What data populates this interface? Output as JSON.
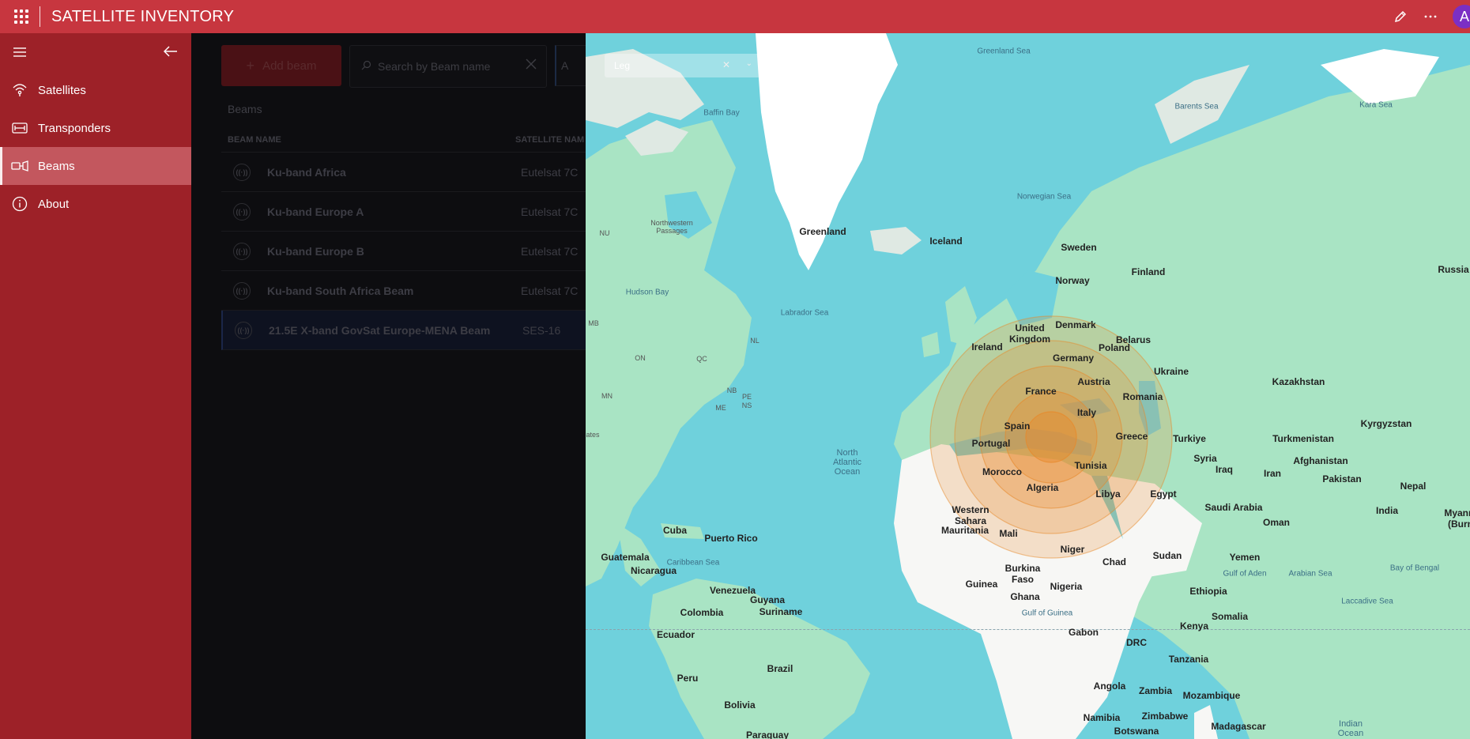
{
  "app": {
    "title": "SATELLITE INVENTORY",
    "avatar_initial": "A"
  },
  "sidebar": {
    "items": [
      {
        "label": "Satellites",
        "icon": "satellite-dish-icon"
      },
      {
        "label": "Transponders",
        "icon": "transponder-icon"
      },
      {
        "label": "Beams",
        "icon": "beam-icon",
        "active": true
      },
      {
        "label": "About",
        "icon": "info-icon"
      }
    ]
  },
  "toolbar": {
    "add_label": "Add beam",
    "search_placeholder": "Search by Beam name",
    "more_label": "A"
  },
  "grid": {
    "title": "Beams",
    "columns": [
      "BEAM NAME",
      "SATELLITE NAM"
    ],
    "rows": [
      {
        "beam": "Ku-band Africa",
        "satellite": "Eutelsat 7C"
      },
      {
        "beam": "Ku-band Europe A",
        "satellite": "Eutelsat 7C"
      },
      {
        "beam": "Ku-band Europe B",
        "satellite": "Eutelsat 7C"
      },
      {
        "beam": "Ku-band South Africa Beam",
        "satellite": "Eutelsat 7C"
      },
      {
        "beam": "21.5E X-band GovSat Europe-MENA Beam",
        "satellite": "SES-16",
        "selected": true
      }
    ]
  },
  "map": {
    "legend_label": "Leg",
    "labels": {
      "greenland_sea": "Greenland Sea",
      "baffin_bay": "Baffin Bay",
      "barents_sea": "Barents Sea",
      "kara_sea": "Kara Sea",
      "norwegian_sea": "Norwegian Sea",
      "greenland": "Greenland",
      "iceland": "Iceland",
      "nw_passages": "Northwestern\nPassages",
      "nu": "NU",
      "hudson_bay": "Hudson Bay",
      "labrador_sea": "Labrador Sea",
      "sweden": "Sweden",
      "finland": "Finland",
      "norway": "Norway",
      "russia": "Russia",
      "united_kingdom": "United\nKingdom",
      "ireland": "Ireland",
      "denmark": "Denmark",
      "belarus": "Belarus",
      "poland": "Poland",
      "germany": "Germany",
      "ukraine": "Ukraine",
      "austria": "Austria",
      "france": "France",
      "romania": "Romania",
      "italy": "Italy",
      "kazakhstan": "Kazakhstan",
      "spain": "Spain",
      "portugal": "Portugal",
      "greece": "Greece",
      "turkiye": "Turkiye",
      "kyrgyzstan": "Kyrgyzstan",
      "turkmenistan": "Turkmenistan",
      "tunisia": "Tunisia",
      "syria": "Syria",
      "afghanistan": "Afghanistan",
      "iraq": "Iraq",
      "iran": "Iran",
      "pakistan": "Pakistan",
      "morocco": "Morocco",
      "algeria": "Algeria",
      "libya": "Libya",
      "egypt": "Egypt",
      "north_atlantic": "North\nAtlantic\nOcean",
      "western_sahara": "Western\nSahara",
      "saudi_arabia": "Saudi Arabia",
      "oman": "Oman",
      "india": "India",
      "nepal": "Nepal",
      "mauritania": "Mauritania",
      "mali": "Mali",
      "niger": "Niger",
      "chad": "Chad",
      "sudan": "Sudan",
      "yemen": "Yemen",
      "cuba": "Cuba",
      "puerto_rico": "Puerto Rico",
      "guatemala": "Guatemala",
      "nicaragua": "Nicaragua",
      "caribbean_sea": "Caribbean Sea",
      "burkina_faso": "Burkina\nFaso",
      "guinea": "Guinea",
      "ghana": "Ghana",
      "nigeria": "Nigeria",
      "ethiopia": "Ethiopia",
      "gulf_of_aden": "Gulf of Aden",
      "arabian_sea": "Arabian Sea",
      "bay_of_bengal": "Bay of Bengal",
      "venezuela": "Venezuela",
      "guyana": "Guyana",
      "suriname": "Suriname",
      "colombia": "Colombia",
      "gulf_of_guinea": "Gulf of Guinea",
      "somalia": "Somalia",
      "kenya": "Kenya",
      "ecuador": "Ecuador",
      "gabon": "Gabon",
      "drc": "DRC",
      "tanzania": "Tanzania",
      "laccadive_sea": "Laccadive Sea",
      "brazil": "Brazil",
      "peru": "Peru",
      "angola": "Angola",
      "zambia": "Zambia",
      "mozambique": "Mozambique",
      "bolivia": "Bolivia",
      "namibia": "Namibia",
      "zimbabwe": "Zimbabwe",
      "madagascar": "Madagascar",
      "botswana": "Botswana",
      "paraguay": "Paraguay",
      "indian_ocean": "Indian\nOcean",
      "myanmar": "Myanm\n(Burn",
      "mb": "MB",
      "on": "ON",
      "qc": "QC",
      "nl": "NL",
      "mn": "MN",
      "nb": "NB",
      "pe": "PE",
      "ns": "NS",
      "me": "ME",
      "states": "ates"
    }
  },
  "colors": {
    "topbar": "#c7363f",
    "sidebar": "#9d2128",
    "active_nav": "#c3575e",
    "beam_orange": "#e8892a",
    "water": "#6fd1dc",
    "land": "#a9e4c4"
  }
}
